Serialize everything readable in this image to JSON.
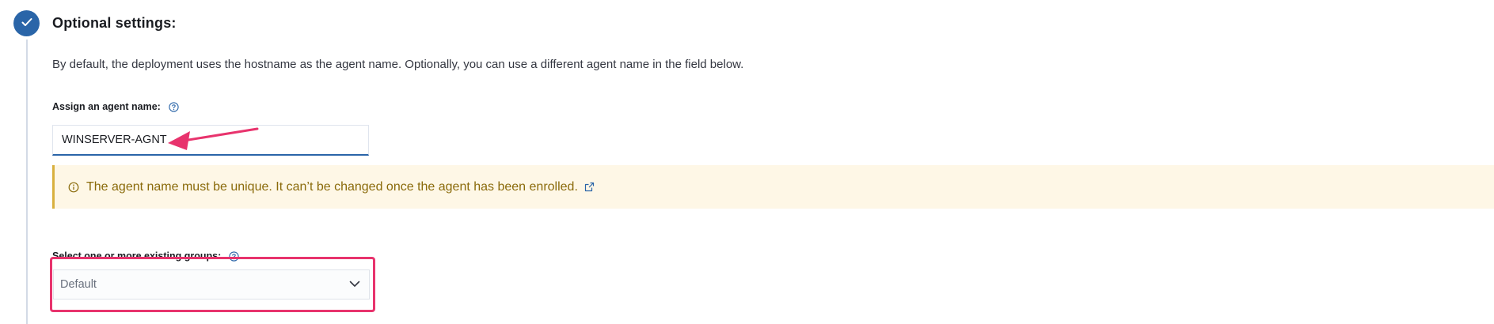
{
  "section": {
    "title": "Optional settings:",
    "description": "By default, the deployment uses the hostname as the agent name. Optionally, you can use a different agent name in the field below."
  },
  "agent_name": {
    "label": "Assign an agent name:",
    "value": "WINSERVER-AGNT"
  },
  "callout": {
    "text": "The agent name must be unique. It can’t be changed once the agent has been enrolled."
  },
  "groups": {
    "label": "Select one or more existing groups:",
    "selected": "Default"
  },
  "colors": {
    "step_badge": "#2a65a8",
    "callout_background": "#fef7e6",
    "callout_text": "#8a6a0a",
    "annotation": "#e8336d"
  },
  "icons": [
    "check-icon",
    "help-icon",
    "info-icon",
    "external-link-icon",
    "chevron-down-icon"
  ]
}
